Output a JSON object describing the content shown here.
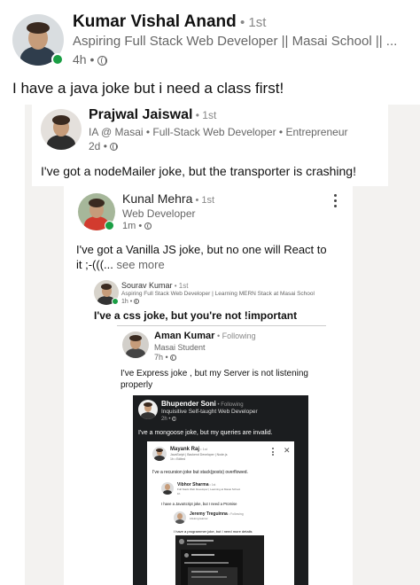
{
  "post": {
    "author": "Kumar Vishal Anand",
    "degree": "1st",
    "headline": "Aspiring Full Stack Web Developer || Masai School || ...",
    "time": "4h",
    "text": "I have a java joke but i need a class first!"
  },
  "c1": {
    "author": "Prajwal Jaiswal",
    "degree": "1st",
    "headline": "IA @ Masai • Full-Stack Web Developer • Entrepreneur",
    "time": "2d",
    "text": "I've got a nodeMailer joke, but the transporter is crashing!"
  },
  "c2": {
    "author": "Kunal Mehra",
    "degree": "1st",
    "headline": "Web Developer",
    "time": "1m",
    "text_line1": "I've got a Vanilla JS joke, but no one will React to",
    "text_line2": "it ;-(((...",
    "see_more": "see more",
    "menu_icon": "more-vertical-icon"
  },
  "c3": {
    "author": "Sourav Kumar",
    "degree": "1st",
    "headline": "Aspiring Full Stack Web Developer | Learning MERN Stack at Masai School",
    "time": "1h",
    "text": "I've a css joke, but you're not !important"
  },
  "c4": {
    "author": "Aman Kumar",
    "follow": "Following",
    "headline": "Masai Student",
    "time": "7h",
    "text_line1": "I've Express joke , but my Server is not listening",
    "text_line2": "properly"
  },
  "c5": {
    "author": "Bhupender Soni",
    "follow": "Following",
    "headline": "Inquisitive Self-taught Web Developer",
    "time": "2h",
    "text": "I've a mongoose joke, but my queries are invalid."
  },
  "c6": {
    "author": "Mayank Raj",
    "degree": "1st",
    "headline": "JavaScript | Backend Developer | Node.js",
    "time": "1h",
    "edited": "Edited",
    "text": "I've a recursion joke but stack(posts) overflowed.",
    "close_icon": "close-icon"
  },
  "c7": {
    "author": "Vibhor Sharma",
    "degree": "1st",
    "headline": "Full Stack Web Developer | Learning at Masai School",
    "time": "1h",
    "text": "I have a JavaScript joke, but I need a Promise"
  },
  "c8": {
    "author": "Jeremy Treguinna",
    "follow": "Following",
    "headline": "Lifelong learner",
    "text": "I have a programmer joke, but I need more details"
  }
}
